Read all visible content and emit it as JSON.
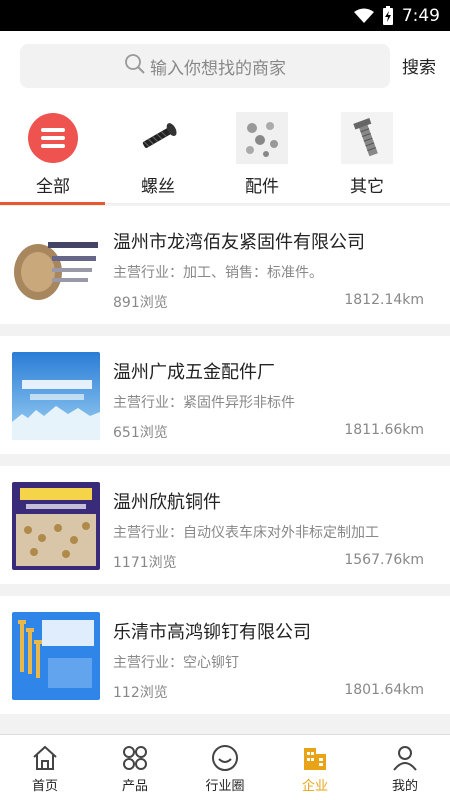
{
  "status": {
    "time": "7:49"
  },
  "search": {
    "placeholder": "输入你想找的商家",
    "button_label": "搜索"
  },
  "categories": [
    {
      "label": "全部",
      "icon": "list-icon",
      "active": true
    },
    {
      "label": "螺丝",
      "icon": "screw-icon"
    },
    {
      "label": "配件",
      "icon": "fittings-icon"
    },
    {
      "label": "其它",
      "icon": "bolt-icon"
    }
  ],
  "companies": [
    {
      "name": "温州市龙湾佰友紧固件有限公司",
      "industry": "主营行业：加工、销售：标准件。",
      "views": "891浏览",
      "distance": "1812.14km"
    },
    {
      "name": "温州广成五金配件厂",
      "industry": "主营行业：紧固件异形非标件",
      "views": "651浏览",
      "distance": "1811.66km"
    },
    {
      "name": "温州欣航铜件",
      "industry": "主营行业：自动仪表车床对外非标定制加工",
      "views": "1171浏览",
      "distance": "1567.76km"
    },
    {
      "name": "乐清市高鸿铆钉有限公司",
      "industry": "主营行业：空心铆钉",
      "views": "112浏览",
      "distance": "1801.64km"
    }
  ],
  "tabs": [
    {
      "label": "首页",
      "icon": "home-icon"
    },
    {
      "label": "产品",
      "icon": "grid-icon"
    },
    {
      "label": "行业圈",
      "icon": "smile-icon"
    },
    {
      "label": "企业",
      "icon": "building-icon",
      "active": true
    },
    {
      "label": "我的",
      "icon": "user-icon"
    }
  ],
  "colors": {
    "accent": "#e8582f",
    "active_tab": "#e8a317",
    "all_icon_bg": "#ef5350"
  }
}
